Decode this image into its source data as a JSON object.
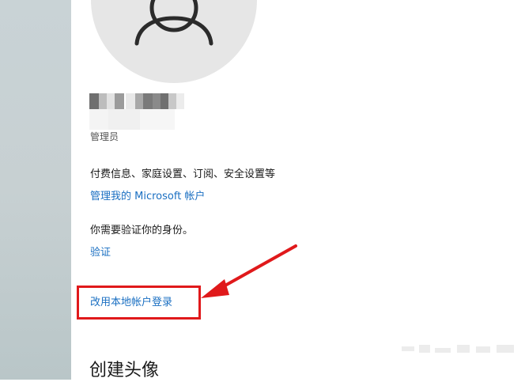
{
  "account": {
    "role": "管理员",
    "info_text": "付费信息、家庭设置、订阅、安全设置等",
    "manage_link": "管理我的 Microsoft 帐户",
    "verify_prompt": "你需要验证你的身份。",
    "verify_link": "验证",
    "local_login_link": "改用本地帐户登录"
  },
  "section": {
    "create_avatar_title": "创建头像"
  },
  "colors": {
    "link": "#1a6fc2",
    "annotation": "#e0191b",
    "avatar_bg": "#e6e6e6"
  },
  "icons": {
    "avatar": "user-silhouette-icon",
    "annotation_arrow": "red-arrow-icon"
  }
}
